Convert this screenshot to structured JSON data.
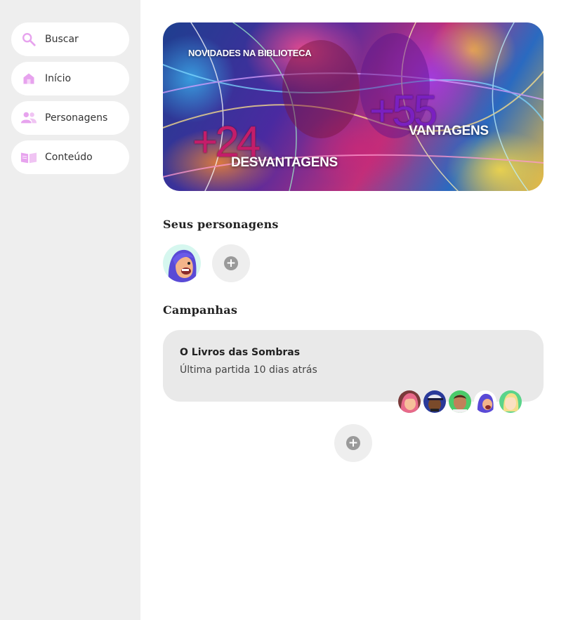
{
  "sidebar": {
    "items": [
      {
        "label": "Buscar",
        "icon": "search-icon"
      },
      {
        "label": "Início",
        "icon": "home-icon"
      },
      {
        "label": "Personagens",
        "icon": "people-icon"
      },
      {
        "label": "Conteúdo",
        "icon": "book-icon"
      }
    ],
    "icon_color": "#e7a3ee"
  },
  "banner": {
    "label": "NOVIDADES NA BIBLIOTECA",
    "stat_1": {
      "number": "+24",
      "word": "DESVANTAGENS"
    },
    "stat_2": {
      "number": "+55",
      "word": "VANTAGENS"
    }
  },
  "characters": {
    "title": "Seus personagens",
    "items": [
      {
        "avatar": "purple-hair-character"
      }
    ],
    "add_symbol": "+"
  },
  "campaigns": {
    "title": "Campanhas",
    "items": [
      {
        "title": "O Livros das Sombras",
        "subtitle": "Última partida 10 dias atrás",
        "party": [
          "pink-hair-avatar",
          "cap-avatar",
          "green-avatar",
          "purple-hair-avatar",
          "blonde-avatar"
        ]
      }
    ],
    "add_symbol": "+"
  },
  "colors": {
    "sidebar_bg": "#eeeeee",
    "card_bg": "#e9e9e9",
    "accent": "#e7a3ee"
  }
}
